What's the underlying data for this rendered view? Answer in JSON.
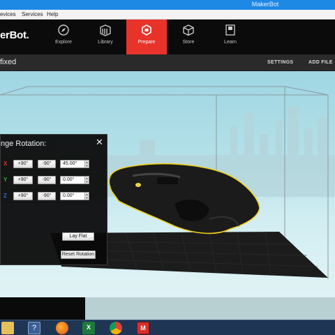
{
  "window": {
    "title": "MakerBot"
  },
  "menu": {
    "items": [
      "evices",
      "Services",
      "Help"
    ]
  },
  "nav": {
    "logo": "erBot.",
    "items": [
      {
        "label": "Explore",
        "icon": "compass-icon"
      },
      {
        "label": "Library",
        "icon": "library-icon"
      },
      {
        "label": "Prepare",
        "icon": "prepare-icon"
      },
      {
        "label": "Store",
        "icon": "store-cube-icon"
      },
      {
        "label": "Learn",
        "icon": "learn-book-icon"
      }
    ],
    "active": "Prepare"
  },
  "subheader": {
    "filename": "fixed",
    "settings_label": "SETTINGS",
    "add_file_label": "ADD FILE"
  },
  "rotation_panel": {
    "title": "nge Rotation:",
    "close_glyph": "✕",
    "axes": [
      {
        "axis": "X",
        "color": "#d33a2c",
        "plus": "+90°",
        "minus": "-90°",
        "value": "45.00°"
      },
      {
        "axis": "Y",
        "color": "#2fae3c",
        "plus": "+90°",
        "minus": "-90°",
        "value": "0.00°"
      },
      {
        "axis": "Z",
        "color": "#2f6fd1",
        "plus": "+90°",
        "minus": "-90°",
        "value": "0.00°"
      }
    ],
    "lay_flat_label": "Lay Flat",
    "reset_label": "Reset Rotation"
  },
  "colors": {
    "accent": "#e8332a",
    "titlebar": "#1e88e5",
    "selection_outline": "#f2d21b"
  },
  "taskbar": {
    "icons": [
      "file-explorer-icon",
      "help-icon",
      "firefox-icon",
      "excel-icon",
      "chrome-icon",
      "makerbot-icon"
    ]
  }
}
